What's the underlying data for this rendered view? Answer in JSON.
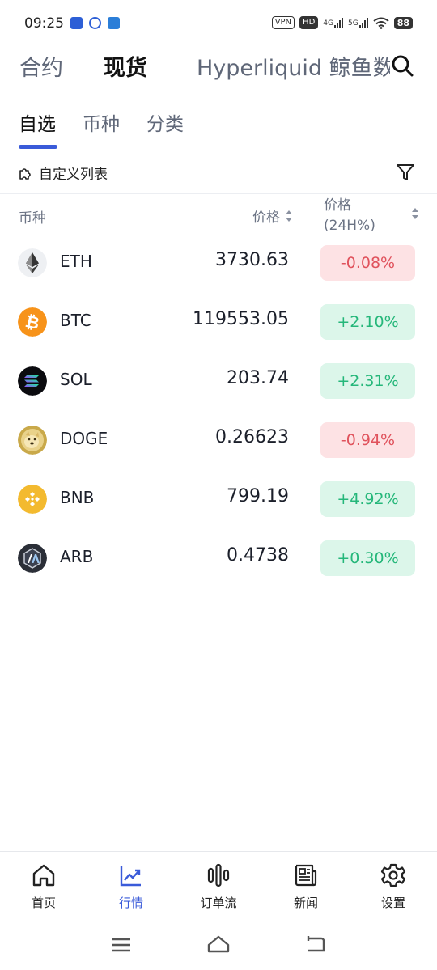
{
  "status_bar": {
    "time": "09:25",
    "vpn": "VPN",
    "hd": "HD",
    "net1": "4G",
    "net2": "5G",
    "battery": "88"
  },
  "top_tabs": [
    {
      "label": "合约",
      "active": false
    },
    {
      "label": "现货",
      "active": true
    },
    {
      "label": "Hyperliquid 鲸鱼数",
      "active": false
    }
  ],
  "sub_tabs": [
    {
      "label": "自选",
      "active": true
    },
    {
      "label": "币种",
      "active": false
    },
    {
      "label": "分类",
      "active": false
    }
  ],
  "custom_list": {
    "label": "自定义列表"
  },
  "table_header": {
    "coin": "币种",
    "price": "价格",
    "change_line1": "价格",
    "change_line2": "(24H%)"
  },
  "coins": [
    {
      "symbol": "ETH",
      "price": "3730.63",
      "change": "-0.08%",
      "direction": "down",
      "logo_color": "#eef0f3",
      "icon": "ethereum-icon"
    },
    {
      "symbol": "BTC",
      "price": "119553.05",
      "change": "+2.10%",
      "direction": "up",
      "logo_color": "#f7931a",
      "icon": "bitcoin-icon"
    },
    {
      "symbol": "SOL",
      "price": "203.74",
      "change": "+2.31%",
      "direction": "up",
      "logo_color": "#0b0b0f",
      "icon": "solana-icon"
    },
    {
      "symbol": "DOGE",
      "price": "0.26623",
      "change": "-0.94%",
      "direction": "down",
      "logo_color": "#c9a94a",
      "icon": "dogecoin-icon"
    },
    {
      "symbol": "BNB",
      "price": "799.19",
      "change": "+4.92%",
      "direction": "up",
      "logo_color": "#f3ba2f",
      "icon": "bnb-icon"
    },
    {
      "symbol": "ARB",
      "price": "0.4738",
      "change": "+0.30%",
      "direction": "up",
      "logo_color": "#2b2f38",
      "icon": "arbitrum-icon"
    }
  ],
  "bottom_nav": [
    {
      "label": "首页",
      "icon": "home-icon",
      "active": false
    },
    {
      "label": "行情",
      "icon": "market-chart-icon",
      "active": true
    },
    {
      "label": "订单流",
      "icon": "order-flow-icon",
      "active": false
    },
    {
      "label": "新闻",
      "icon": "news-icon",
      "active": false
    },
    {
      "label": "设置",
      "icon": "settings-gear-icon",
      "active": false
    }
  ],
  "colors": {
    "accent": "#3a5bd9",
    "up_text": "#25b77a",
    "up_bg": "#dcf6ea",
    "down_text": "#e0525c",
    "down_bg": "#fde2e4"
  }
}
